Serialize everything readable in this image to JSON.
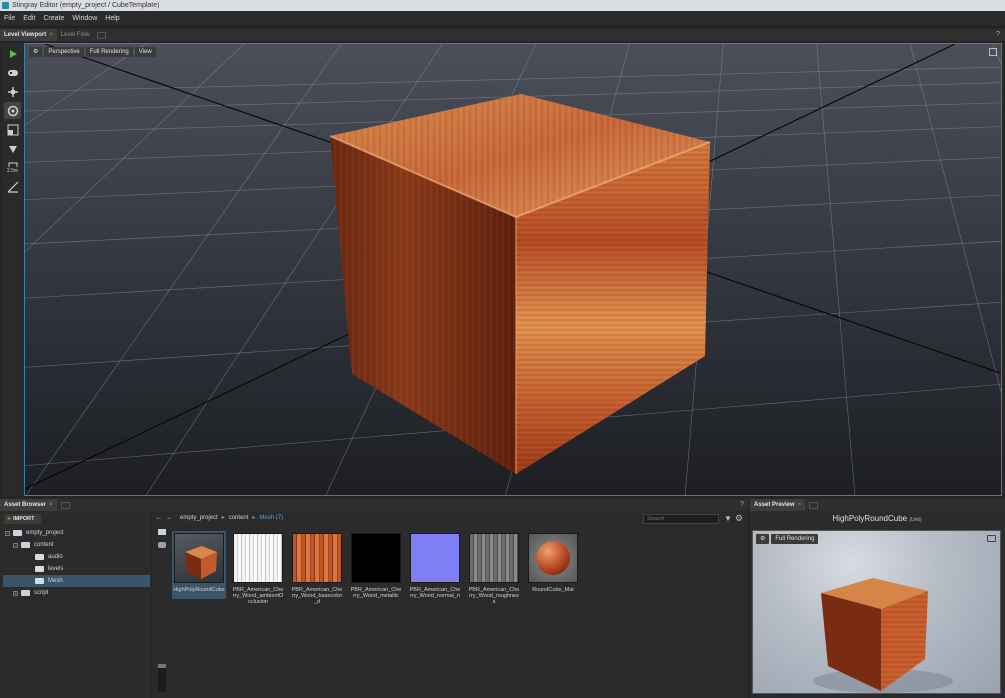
{
  "window": {
    "title": "Stingray Editor (empty_project / CubeTemplate)"
  },
  "menu": [
    "File",
    "Edit",
    "Create",
    "Window",
    "Help"
  ],
  "top_tabs": {
    "active": "Level Viewport",
    "inactive": "Level Flow"
  },
  "viewport": {
    "toolbar": {
      "gear": "⚙",
      "camera": "Perspective",
      "render_mode": "Full Rendering",
      "view_menu": "View"
    },
    "side_tools": [
      "play-icon",
      "gamepad-icon",
      "move-icon",
      "rotate-icon",
      "scale-icon",
      "snap-icon",
      "grid-size-icon",
      "measure-icon"
    ],
    "grid_label": "2.5m"
  },
  "asset_browser": {
    "tab_label": "Asset Browser",
    "import_label": "IMPORT",
    "tree": [
      {
        "label": "empty_project",
        "depth": 0,
        "expanded": true
      },
      {
        "label": "content",
        "depth": 1,
        "expanded": true
      },
      {
        "label": "audio",
        "depth": 2
      },
      {
        "label": "levels",
        "depth": 2
      },
      {
        "label": "Mesh",
        "depth": 2,
        "selected": true
      },
      {
        "label": "script",
        "depth": 1,
        "expanded": false
      }
    ],
    "breadcrumb": [
      "empty_project",
      "content"
    ],
    "breadcrumb_current": "Mesh (7)",
    "search_placeholder": "Search",
    "assets": [
      {
        "label": "HighPolyRoundCube",
        "selected": true,
        "thumb": "wood-cube"
      },
      {
        "label": "PBR_American_Cherry_Wood_ambientOcclusion",
        "thumb": "white-wood"
      },
      {
        "label": "PBR_American_Cherry_Wood_basecolor_d",
        "thumb": "cherry-wood"
      },
      {
        "label": "PBR_American_Cherry_Wood_metallic",
        "thumb": "black"
      },
      {
        "label": "PBR_American_Cherry_Wood_normal_n",
        "thumb": "normal-blue"
      },
      {
        "label": "PBR_American_Cherry_Wood_roughness",
        "thumb": "gray-wood"
      },
      {
        "label": "RoundCube_Mat",
        "thumb": "sphere"
      }
    ]
  },
  "asset_preview": {
    "tab_label": "Asset Preview",
    "title": "HighPolyRoundCube",
    "unit": "(Unit)",
    "render_mode": "Full Rendering"
  },
  "colors": {
    "accent": "#3c7fa8",
    "selection": "#3a5568",
    "wood_light": "#d9753a",
    "wood_dark": "#7a2a12"
  }
}
